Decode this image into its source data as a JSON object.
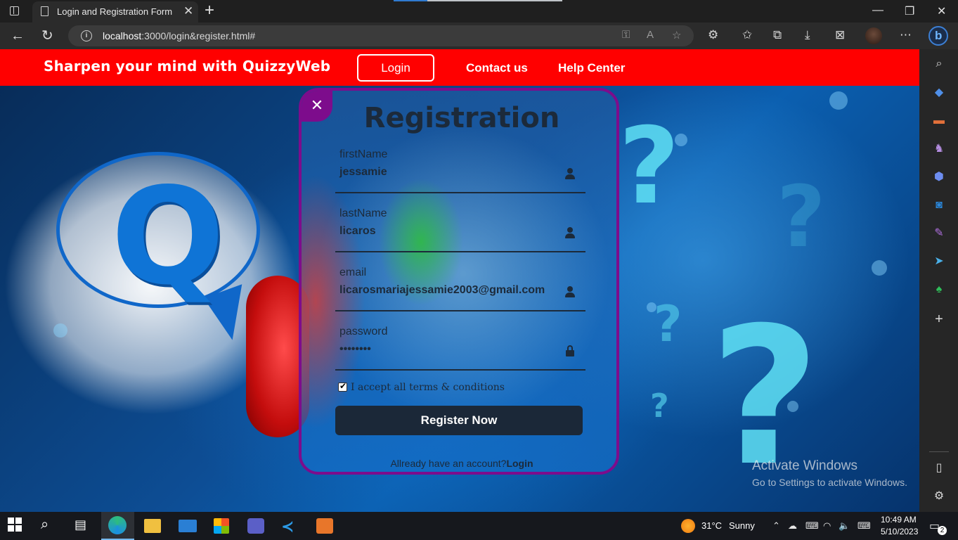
{
  "browser": {
    "tab_title": "Login and Registration Form",
    "url_host": "localhost",
    "url_rest": ":3000/login&register.html#"
  },
  "navbar": {
    "brand": "Sharpen your mind with QuizzyWeb",
    "login": "Login",
    "contact": "Contact us",
    "help": "Help Center"
  },
  "form": {
    "close": "✕",
    "title": "Registration",
    "fields": [
      {
        "label": "firstName",
        "value": "jessamie",
        "icon": "person-icon"
      },
      {
        "label": "lastName",
        "value": "licaros",
        "icon": "person-icon"
      },
      {
        "label": "email",
        "value": "licarosmariajessamie2003@gmail.com",
        "icon": "person-icon"
      },
      {
        "label": "password",
        "value": "••••••••",
        "icon": "lock-icon"
      }
    ],
    "terms": "I accept all terms & conditions",
    "terms_checked": true,
    "register": "Register Now",
    "account_prefix": "Allready have an account?",
    "account_link": "Login"
  },
  "watermark": {
    "line1": "Activate Windows",
    "line2": "Go to Settings to activate Windows."
  },
  "taskbar": {
    "weather_temp": "31°C",
    "weather_desc": "Sunny",
    "time": "10:49 AM",
    "date": "5/10/2023",
    "notifications": "2"
  },
  "colors": {
    "navbar": "#ff0000",
    "card_border": "#7d0c8c",
    "button": "#1b2838"
  }
}
